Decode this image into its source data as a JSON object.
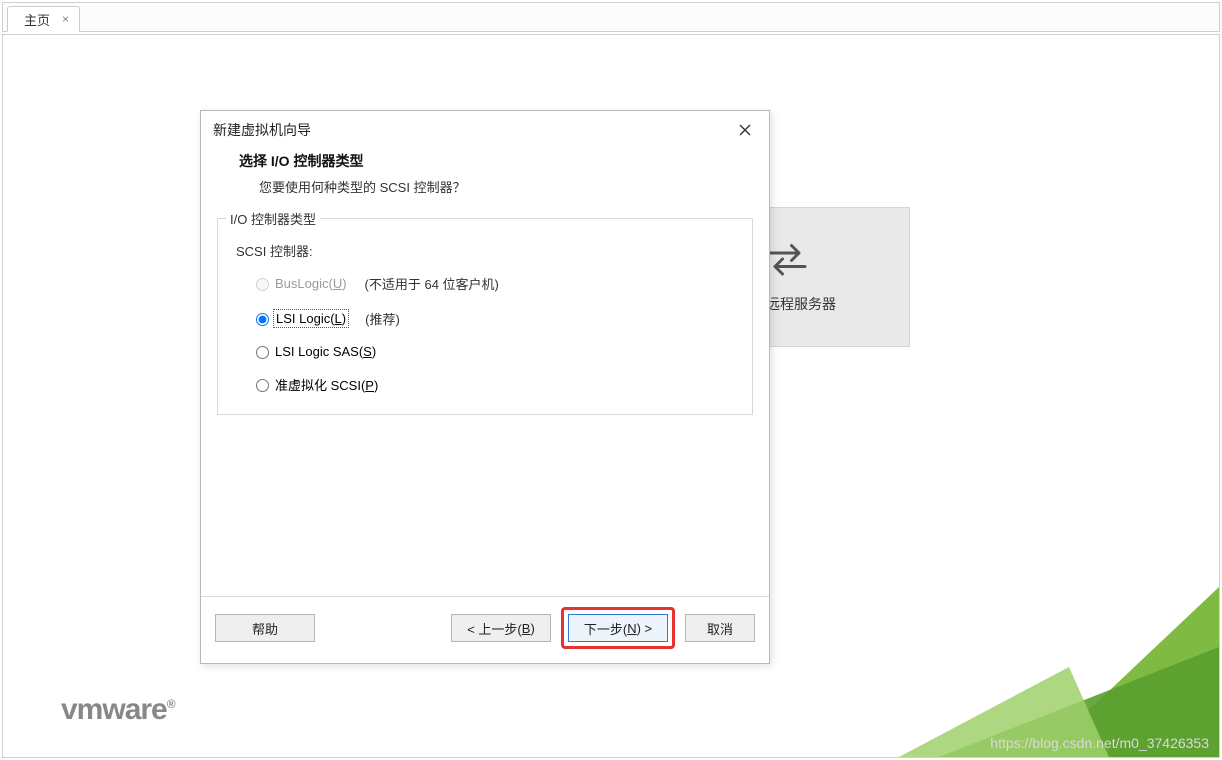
{
  "tab": {
    "title": "主页"
  },
  "remote_button": {
    "label": "连接远程服务器"
  },
  "vmware": {
    "text": "vmware"
  },
  "watermark": "https://blog.csdn.net/m0_37426353",
  "dialog": {
    "title": "新建虚拟机向导",
    "header_title": "选择 I/O 控制器类型",
    "header_sub": "您要使用何种类型的 SCSI 控制器？",
    "group_legend": "I/O 控制器类型",
    "sublabel": "SCSI 控制器:",
    "options": [
      {
        "label_pre": "BusLogic(",
        "hotkey": "U",
        "label_post": ")",
        "note": "(不适用于 64 位客户机)",
        "enabled": false,
        "checked": false
      },
      {
        "label_pre": "LSI Logic(",
        "hotkey": "L",
        "label_post": ")",
        "note": "(推荐)",
        "enabled": true,
        "checked": true
      },
      {
        "label_pre": "LSI Logic SAS(",
        "hotkey": "S",
        "label_post": ")",
        "note": "",
        "enabled": true,
        "checked": false
      },
      {
        "label_pre": "准虚拟化 SCSI(",
        "hotkey": "P",
        "label_post": ")",
        "note": "",
        "enabled": true,
        "checked": false
      }
    ],
    "buttons": {
      "help": "帮助",
      "back_pre": "< 上一步(",
      "back_hot": "B",
      "back_post": ")",
      "next_pre": "下一步(",
      "next_hot": "N",
      "next_post": ") >",
      "cancel": "取消"
    }
  }
}
